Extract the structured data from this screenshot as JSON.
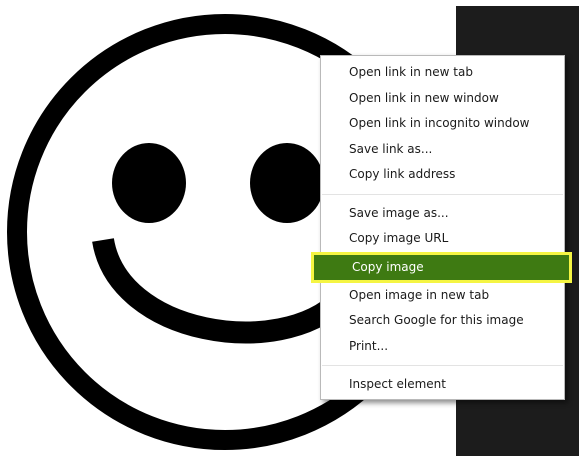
{
  "context_menu": {
    "link_items": [
      "Open link in new tab",
      "Open link in new window",
      "Open link in incognito window",
      "Save link as...",
      "Copy link address"
    ],
    "image_items": [
      "Save image as...",
      "Copy image URL",
      "Copy image",
      "Open image in new tab",
      "Search Google for this image",
      "Print..."
    ],
    "inspect_items": [
      "Inspect element"
    ],
    "highlighted_item": "Copy image",
    "highlight_color": "#3e7a12",
    "highlight_outline_color": "#f5f543"
  },
  "background_image": {
    "icon": "smiley-face-icon",
    "color": "#000000"
  }
}
